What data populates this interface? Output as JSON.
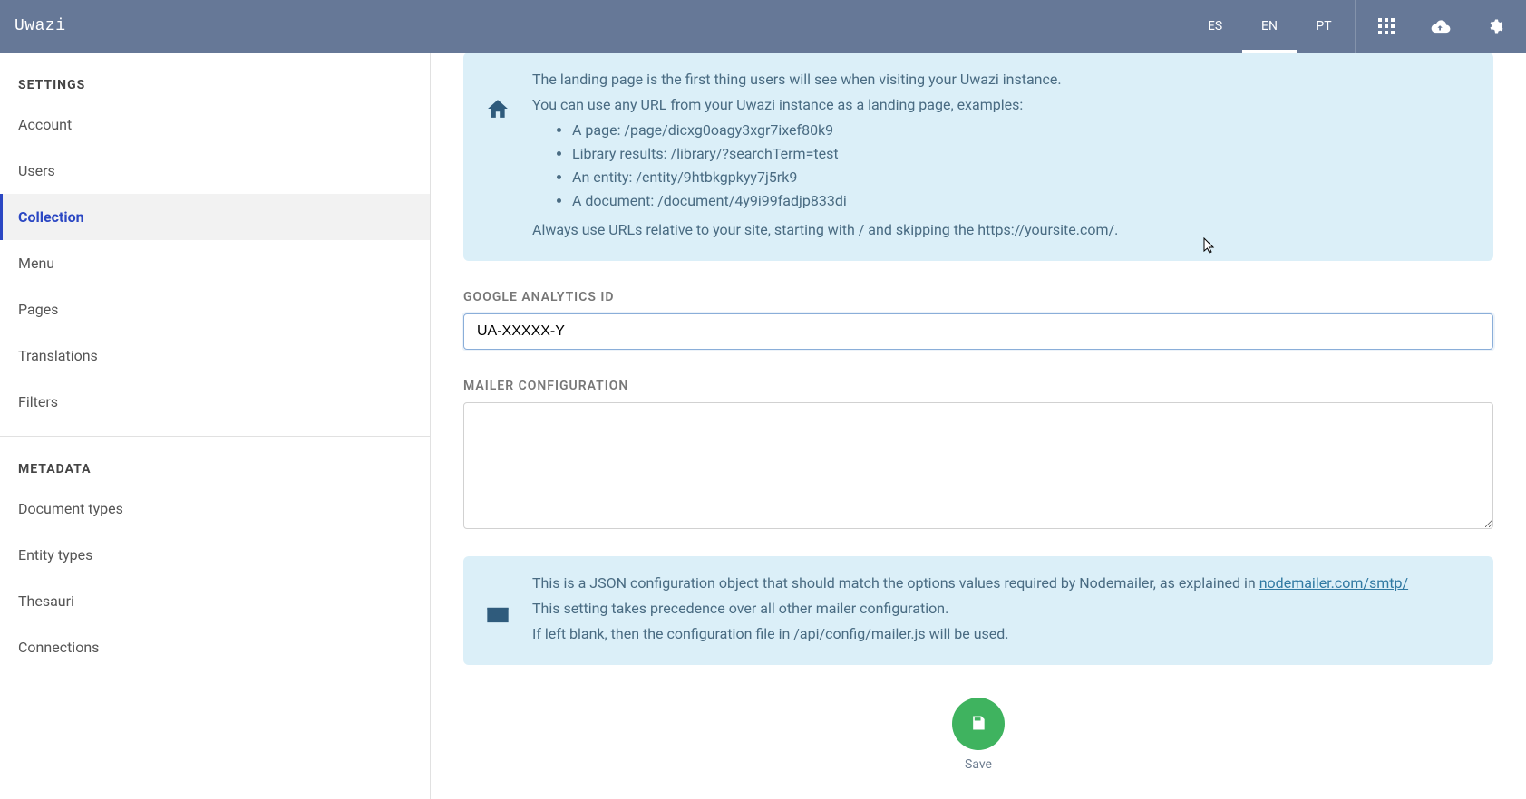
{
  "brand": "Uwazi",
  "languages": {
    "es": "ES",
    "en": "EN",
    "pt": "PT"
  },
  "sidebar": {
    "settings_title": "SETTINGS",
    "items": {
      "account": "Account",
      "users": "Users",
      "collection": "Collection",
      "menu": "Menu",
      "pages": "Pages",
      "translations": "Translations",
      "filters": "Filters"
    },
    "metadata_title": "METADATA",
    "metadata_items": {
      "document_types": "Document types",
      "entity_types": "Entity types",
      "thesauri": "Thesauri",
      "connections": "Connections"
    }
  },
  "landing_box": {
    "p1": "The landing page is the first thing users will see when visiting your Uwazi instance.",
    "p2": "You can use any URL from your Uwazi instance as a landing page, examples:",
    "examples": {
      "page": "A page: /page/dicxg0oagy3xgr7ixef80k9",
      "library": "Library results: /library/?searchTerm=test",
      "entity": "An entity: /entity/9htbkgpkyy7j5rk9",
      "document": "A document: /document/4y9i99fadjp833di"
    },
    "p3": "Always use URLs relative to your site, starting with / and skipping the https://yoursite.com/."
  },
  "ga": {
    "label": "GOOGLE ANALYTICS ID",
    "value": "UA-XXXXX-Y"
  },
  "mailer": {
    "label": "MAILER CONFIGURATION",
    "value": ""
  },
  "mailer_box": {
    "p1": "This is a JSON configuration object that should match the options values required by Nodemailer, as explained in ",
    "link_text": "nodemailer.com/smtp/",
    "p2": "This setting takes precedence over all other mailer configuration.",
    "p3": "If left blank, then the configuration file in /api/config/mailer.js will be used."
  },
  "save": {
    "label": "Save"
  }
}
